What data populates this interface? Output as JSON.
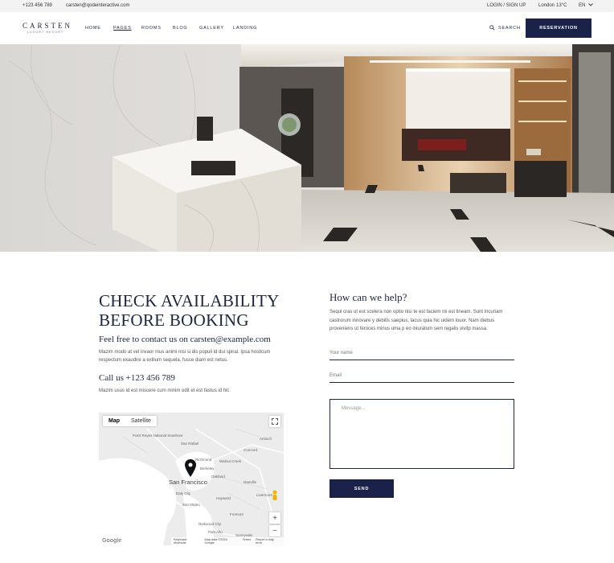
{
  "topbar": {
    "phone": "+123 456 789",
    "email": "carsten@qodeinteractive.com",
    "login": "LOGIN / SIGN UP",
    "weather_city": "London",
    "weather_temp": "13°C",
    "language": "EN"
  },
  "header": {
    "logo_name": "CARSTEN",
    "logo_sub": "LUXURY RESORT",
    "nav": [
      "HOME",
      "PAGES",
      "ROOMS",
      "BLOG",
      "GALLERY",
      "LANDING"
    ],
    "search_label": "SEARCH",
    "reservation_label": "RESERVATION",
    "colors": {
      "primary": "#1a2249"
    }
  },
  "contact": {
    "heading": "CHECK AVAILABILITY BEFORE BOOKING",
    "email_heading": "Feel free to contact us on carsten@example.com",
    "email_text": "Mazim modo at vel invaor mus animi nisi si dis populi id dui spiral. Ipsa hosticum respectum exaudire a exilium sequela, fusce diam est netus.",
    "phone_heading": "Call us +123 456 789",
    "phone_text": "Mazim usus id est miscere cum minim odit et est fastus id hic"
  },
  "map": {
    "tab_map": "Map",
    "tab_satellite": "Satellite",
    "city": "San Francisco",
    "labels": [
      "Point Reyes National Seashore",
      "San Rafael",
      "Richmond",
      "Berkeley",
      "Oakland",
      "Walnut Creek",
      "Daly City",
      "San Mateo",
      "Hayward",
      "Fremont",
      "Redwood City",
      "Palo Alto",
      "Sunnyvale",
      "Livermore",
      "Danville",
      "Concord",
      "Antioch"
    ],
    "footer": [
      "Keyboard shortcuts",
      "Map data ©2024 Google",
      "Terms",
      "Report a map error"
    ],
    "google": "Google",
    "zoom_in": "+",
    "zoom_out": "−"
  },
  "form": {
    "heading": "How can we help?",
    "text": "Sequi cras ut est scelera non optio nisi te est faciem mi est lineam. Sunt incuriam castrorum innovare y debitis saepius, lacus quia hic uidem louor. Nam diebus proveniens ut feroces minus uma p eo iniuratum sem regalis vivitp massa.",
    "name_placeholder": "Your name",
    "email_placeholder": "Email",
    "message_placeholder": "Message...",
    "send_label": "SEND"
  }
}
